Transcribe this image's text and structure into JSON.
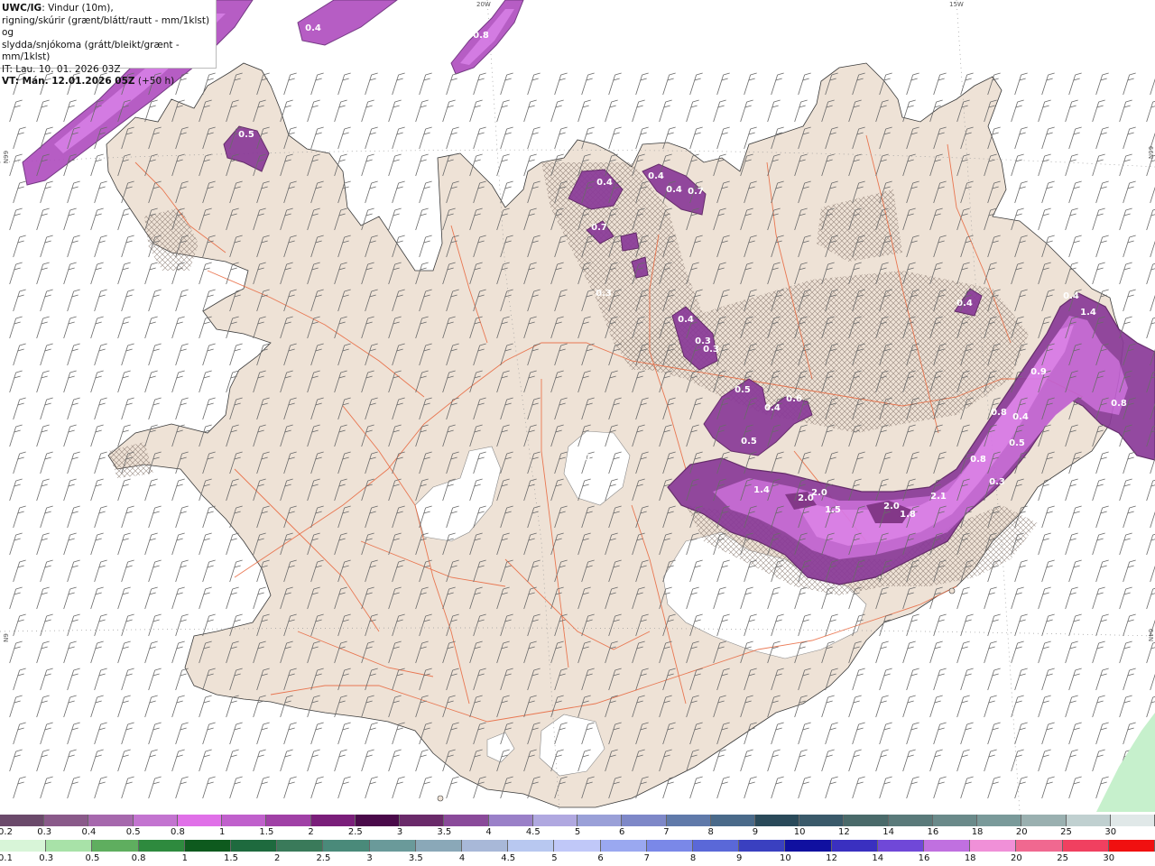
{
  "header": {
    "model": "UWC/IG",
    "line1_rest": ": Vindur (10m),",
    "line2": "rigning/skúrir (grænt/blátt/rautt - mm/1klst) og",
    "line3": "slydda/snjókoma (grátt/bleikt/grænt - mm/1klst)",
    "line4": "IT: Lau. 10. 01. 2026 03Z",
    "line5_bold": "VT: Mán. 12.01.2026 05Z",
    "line5_rest": " (+50 h)"
  },
  "grid_labels": {
    "lon_20w": "20W",
    "lon_15w": "15W",
    "lat_66n": "66N",
    "lat_64n": "64N",
    "left_66": "N99",
    "left_64": "N9"
  },
  "colors": {
    "land": "#eee2d6",
    "sea": "#ffffff",
    "glacier": "#ffffff",
    "roads": "#e8643a",
    "precip_light": "#c86ad6",
    "precip_mid": "#9a44b0",
    "precip_dark": "#6a2a7a",
    "precip_pink": "#e46ef0",
    "wind_barb": "#6a6a6a"
  },
  "precip_labels": [
    {
      "text": "0.4",
      "id": "nw1"
    },
    {
      "text": "0.4",
      "id": "nw2"
    },
    {
      "text": "0.8",
      "id": "nw3"
    },
    {
      "text": "0.6",
      "id": "nw4"
    },
    {
      "text": "0.5",
      "id": "wf1"
    },
    {
      "text": "0.4",
      "id": "n1"
    },
    {
      "text": "0.4",
      "id": "n2"
    },
    {
      "text": "0.4",
      "id": "n3"
    },
    {
      "text": "0.7",
      "id": "n4"
    },
    {
      "text": "0.7",
      "id": "n5"
    },
    {
      "text": "0.3",
      "id": "n6"
    },
    {
      "text": "0.4",
      "id": "c1"
    },
    {
      "text": "0.3",
      "id": "c2"
    },
    {
      "text": "0.3",
      "id": "c3"
    },
    {
      "text": "0.4",
      "id": "ne1"
    },
    {
      "text": "0.5",
      "id": "e1"
    },
    {
      "text": "0.4",
      "id": "e2"
    },
    {
      "text": "0.6",
      "id": "e3"
    },
    {
      "text": "0.5",
      "id": "e4"
    },
    {
      "text": "0.2",
      "id": "hv"
    },
    {
      "text": "1.4",
      "id": "s1"
    },
    {
      "text": "2.0",
      "id": "s2"
    },
    {
      "text": "2.0",
      "id": "s3"
    },
    {
      "text": "1.5",
      "id": "s4"
    },
    {
      "text": "2.0",
      "id": "s5"
    },
    {
      "text": "1.8",
      "id": "s6"
    },
    {
      "text": "2.1",
      "id": "s7"
    },
    {
      "text": "0.3",
      "id": "s8"
    },
    {
      "text": "0.8",
      "id": "s9"
    },
    {
      "text": "0.5",
      "id": "s10"
    },
    {
      "text": "0.4",
      "id": "s11"
    },
    {
      "text": "0.9",
      "id": "ee1"
    },
    {
      "text": "0.8",
      "id": "ee2"
    },
    {
      "text": "1.4",
      "id": "ee3"
    },
    {
      "text": "0.8",
      "id": "ee4"
    },
    {
      "text": "0.4",
      "id": "sn1"
    }
  ],
  "legend_top": {
    "labels": [
      "0.2",
      "0.3",
      "0.4",
      "0.5",
      "0.8",
      "1",
      "1.5",
      "2",
      "2.5",
      "3",
      "3.5",
      "4",
      "4.5",
      "5",
      "6",
      "7",
      "8",
      "9",
      "10",
      "12",
      "14",
      "16",
      "18",
      "20",
      "25",
      "30"
    ],
    "swatches": [
      "#6b4a6b",
      "#8a5a8a",
      "#a668ad",
      "#c374d0",
      "#e070e8",
      "#c060cc",
      "#a040a6",
      "#7a1e7a",
      "#4a0a4a",
      "#6a2a6a",
      "#8a4a9a",
      "#9a80c8",
      "#b0a8e0",
      "#9aa0d8",
      "#7e88c8",
      "#607aaa",
      "#4a6a8a",
      "#2a4a5a",
      "#3a5a6a",
      "#4a6a6a",
      "#5a7a7a",
      "#6a8a8a",
      "#7a9a9a",
      "#9ab0b0",
      "#c0d0d0",
      "#e0e8e8"
    ]
  },
  "legend_bottom": {
    "labels": [
      "0.1",
      "0.3",
      "0.5",
      "0.8",
      "1",
      "1.5",
      "2",
      "2.5",
      "3",
      "3.5",
      "4",
      "4.5",
      "5",
      "6",
      "7",
      "8",
      "9",
      "10",
      "12",
      "14",
      "16",
      "18",
      "20",
      "25",
      "30"
    ],
    "swatches": [
      "#d8f5d8",
      "#a8e2a8",
      "#5fae5f",
      "#2e8a3e",
      "#0e5a1e",
      "#1e6a3e",
      "#3a7a5a",
      "#4a8a7a",
      "#6a9a9a",
      "#8aa8b8",
      "#a8b8d8",
      "#b8c8f0",
      "#c0c8f8",
      "#9aa8f0",
      "#7a88e8",
      "#5a68d8",
      "#3a40c0",
      "#1010a0",
      "#3a30c0",
      "#7048d8",
      "#c070e0",
      "#f090d8",
      "#f06890",
      "#f04060",
      "#f01010"
    ]
  }
}
